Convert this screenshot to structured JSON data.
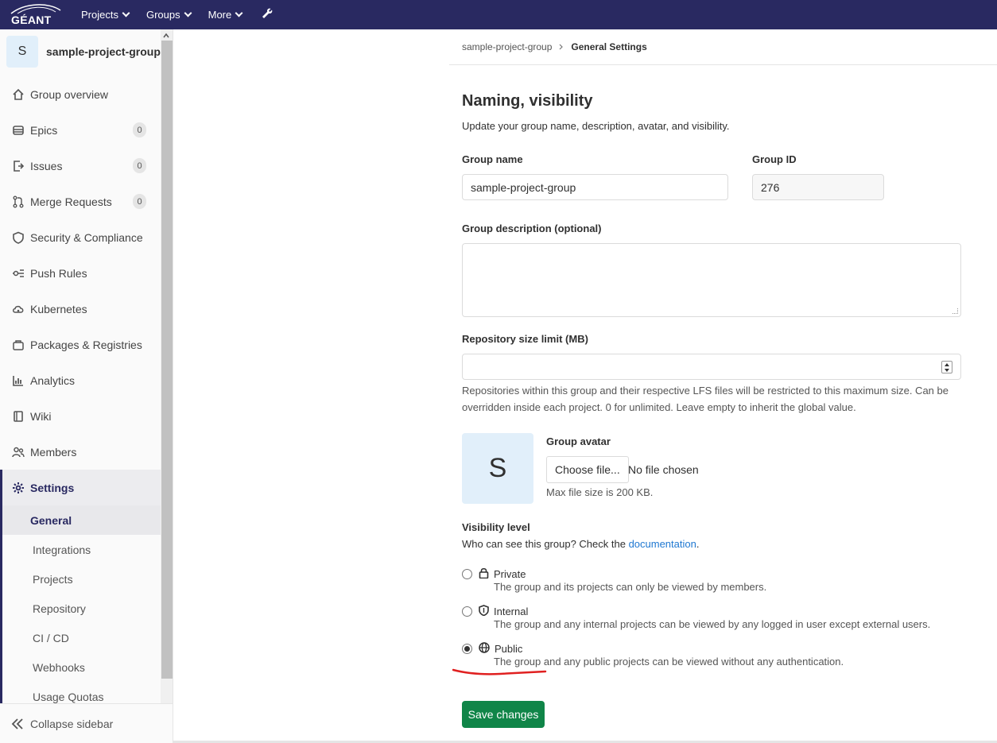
{
  "topbar": {
    "logo_text": "GÉANT",
    "nav": [
      "Projects",
      "Groups",
      "More"
    ],
    "wrench_icon": "wrench-icon"
  },
  "sidebar": {
    "avatar_letter": "S",
    "group_name": "sample-project-group",
    "items": [
      {
        "label": "Group overview",
        "icon": "home-icon"
      },
      {
        "label": "Epics",
        "icon": "epic-icon",
        "badge": "0"
      },
      {
        "label": "Issues",
        "icon": "issues-icon",
        "badge": "0"
      },
      {
        "label": "Merge Requests",
        "icon": "merge-request-icon",
        "badge": "0"
      },
      {
        "label": "Security & Compliance",
        "icon": "shield-icon"
      },
      {
        "label": "Push Rules",
        "icon": "push-rules-icon"
      },
      {
        "label": "Kubernetes",
        "icon": "cloud-gear-icon"
      },
      {
        "label": "Packages & Registries",
        "icon": "package-icon"
      },
      {
        "label": "Analytics",
        "icon": "chart-icon"
      },
      {
        "label": "Wiki",
        "icon": "book-icon"
      },
      {
        "label": "Members",
        "icon": "users-icon"
      },
      {
        "label": "Settings",
        "icon": "gear-icon"
      }
    ],
    "settings_sub": [
      "General",
      "Integrations",
      "Projects",
      "Repository",
      "CI / CD",
      "Webhooks",
      "Usage Quotas"
    ],
    "collapse_label": "Collapse sidebar"
  },
  "breadcrumb": {
    "parent": "sample-project-group",
    "current": "General Settings"
  },
  "section": {
    "title": "Naming, visibility",
    "description": "Update your group name, description, avatar, and visibility."
  },
  "form": {
    "group_name_label": "Group name",
    "group_name_value": "sample-project-group",
    "group_id_label": "Group ID",
    "group_id_value": "276",
    "description_label": "Group description (optional)",
    "repo_limit_label": "Repository size limit (MB)",
    "repo_limit_help": "Repositories within this group and their respective LFS files will be restricted to this maximum size. Can be overridden inside each project. 0 for unlimited. Leave empty to inherit the global value.",
    "avatar_letter": "S",
    "avatar_label": "Group avatar",
    "choose_file": "Choose file...",
    "no_file": "No file chosen",
    "max_size": "Max file size is 200 KB.",
    "visibility_label": "Visibility level",
    "visibility_prefix": "Who can see this group? Check the ",
    "visibility_link": "documentation",
    "visibility_suffix": ".",
    "options": [
      {
        "title": "Private",
        "icon": "lock-icon",
        "desc": "The group and its projects can only be viewed by members.",
        "checked": false
      },
      {
        "title": "Internal",
        "icon": "shield-icon",
        "desc": "The group and any internal projects can be viewed by any logged in user except external users.",
        "checked": false
      },
      {
        "title": "Public",
        "icon": "globe-icon",
        "desc": "The group and any public projects can be viewed without any authentication.",
        "checked": true
      }
    ],
    "save_label": "Save changes"
  },
  "colors": {
    "topbar": "#292961",
    "accent": "#292961",
    "save": "#108548",
    "link": "#1f78d1",
    "annotation": "#e02020"
  }
}
